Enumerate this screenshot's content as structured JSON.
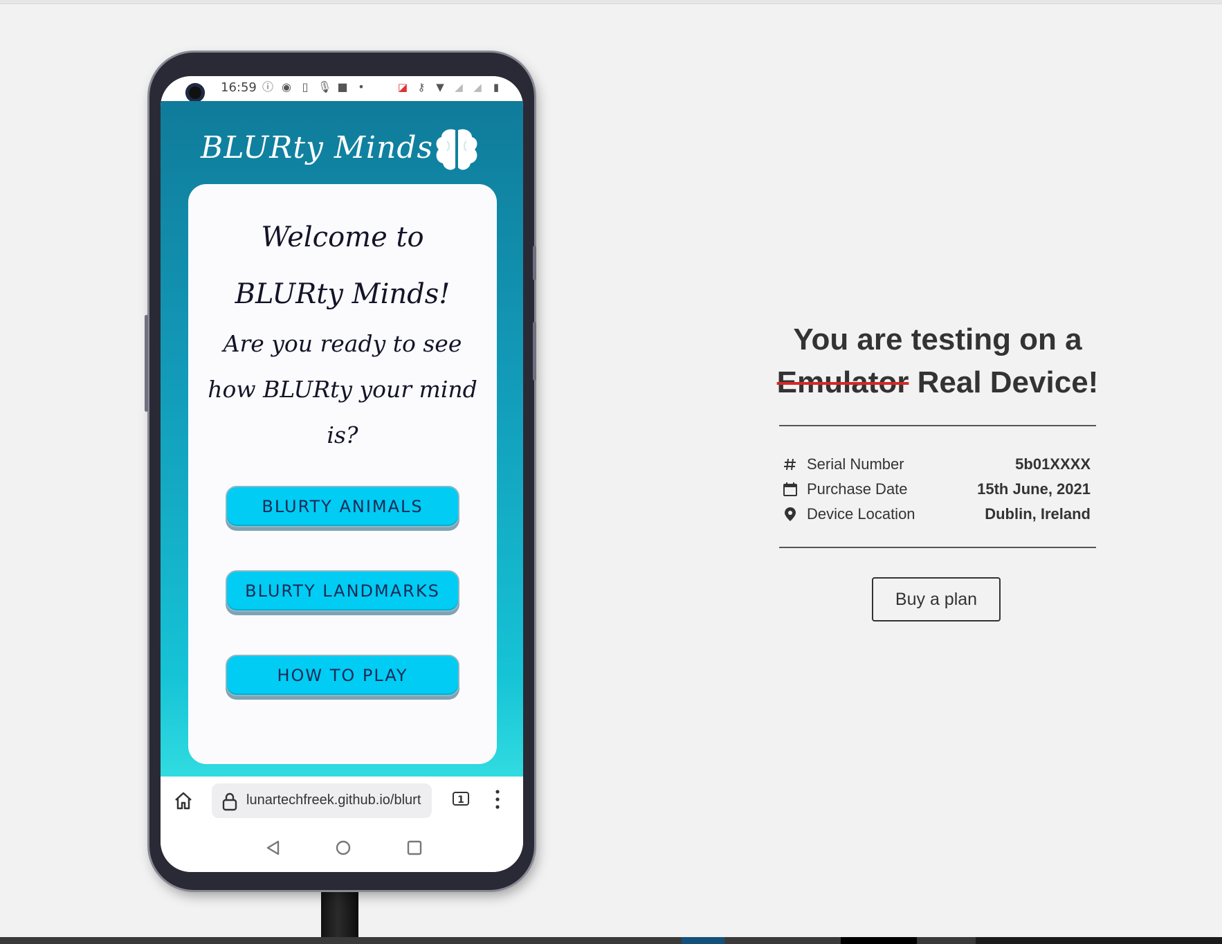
{
  "device": {
    "status_time": "16:59",
    "app_title": "BLURty Minds",
    "welcome_line1": "Welcome to",
    "welcome_line2": "BLURty Minds!",
    "question": "Are you ready to see how BLURty your mind is?",
    "buttons": [
      {
        "label": "BLURTY ANIMALS"
      },
      {
        "label": "BLURTY LANDMARKS"
      },
      {
        "label": "HOW TO PLAY"
      }
    ],
    "browser": {
      "url": "lunartechfreek.github.io/blurt",
      "tab_count": "1"
    }
  },
  "panel": {
    "title_line1": "You are testing on a",
    "title_struck": "Emulator",
    "title_rest": "Real Device!",
    "details": [
      {
        "icon": "hash-icon",
        "label": "Serial Number",
        "value": "5b01XXXX"
      },
      {
        "icon": "calendar-icon",
        "label": "Purchase Date",
        "value": "15th June, 2021"
      },
      {
        "icon": "location-pin-icon",
        "label": "Device Location",
        "value": "Dublin, Ireland"
      }
    ],
    "buy_label": "Buy a plan"
  },
  "colors": {
    "page_bg": "#f2f2f2",
    "app_gradient_top": "#107b9a",
    "app_gradient_bottom": "#30dbe0",
    "game_button": "#00ccf4",
    "strike_red": "#d62828"
  }
}
